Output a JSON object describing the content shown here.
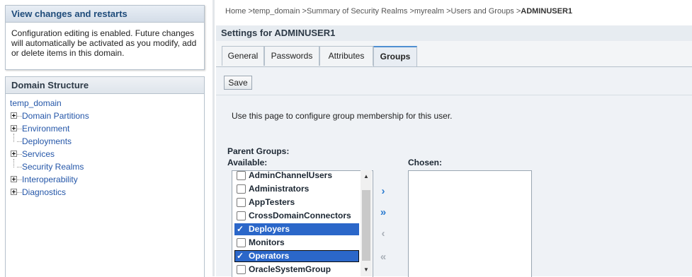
{
  "change_center": {
    "title": "View changes and restarts",
    "message": "Configuration editing is enabled. Future changes will automatically be activated as you modify, add or delete items in this domain."
  },
  "domain_structure": {
    "title": "Domain Structure",
    "root": "temp_domain",
    "items": [
      {
        "label": "Domain Partitions",
        "expandable": true
      },
      {
        "label": "Environment",
        "expandable": true
      },
      {
        "label": "Deployments",
        "expandable": false
      },
      {
        "label": "Services",
        "expandable": true
      },
      {
        "label": "Security Realms",
        "expandable": false
      },
      {
        "label": "Interoperability",
        "expandable": true
      },
      {
        "label": "Diagnostics",
        "expandable": true
      }
    ]
  },
  "breadcrumb": {
    "items": [
      "Home",
      "temp_domain",
      "Summary of Security Realms",
      "myrealm",
      "Users and Groups"
    ],
    "current": "ADMINUSER1",
    "separator": ">"
  },
  "settings": {
    "title": "Settings for ADMINUSER1",
    "tabs": [
      {
        "label": "General",
        "active": false
      },
      {
        "label": "Passwords",
        "active": false
      },
      {
        "label": "Attributes",
        "active": false
      },
      {
        "label": "Groups",
        "active": true
      }
    ],
    "save_label": "Save",
    "help_text": "Use this page to configure group membership for this user."
  },
  "groups": {
    "parent_groups_label": "Parent Groups:",
    "available_label": "Available:",
    "chosen_label": "Chosen:",
    "available": [
      {
        "name": "AdminChannelUsers",
        "checked": false
      },
      {
        "name": "Administrators",
        "checked": false
      },
      {
        "name": "AppTesters",
        "checked": false
      },
      {
        "name": "CrossDomainConnectors",
        "checked": false
      },
      {
        "name": "Deployers",
        "checked": true
      },
      {
        "name": "Monitors",
        "checked": false
      },
      {
        "name": "Operators",
        "checked": true
      },
      {
        "name": "OracleSystemGroup",
        "checked": false
      }
    ],
    "chosen": [],
    "move_buttons": [
      {
        "name": "move-right-icon",
        "glyph": "›",
        "enabled": true
      },
      {
        "name": "move-all-right-icon",
        "glyph": "»",
        "enabled": true
      },
      {
        "name": "move-left-icon",
        "glyph": "‹",
        "enabled": false
      },
      {
        "name": "move-all-left-icon",
        "glyph": "«",
        "enabled": false
      }
    ]
  },
  "colors": {
    "accent": "#2b67c9",
    "link": "#2456a8",
    "header_text": "#1e4b7a"
  }
}
